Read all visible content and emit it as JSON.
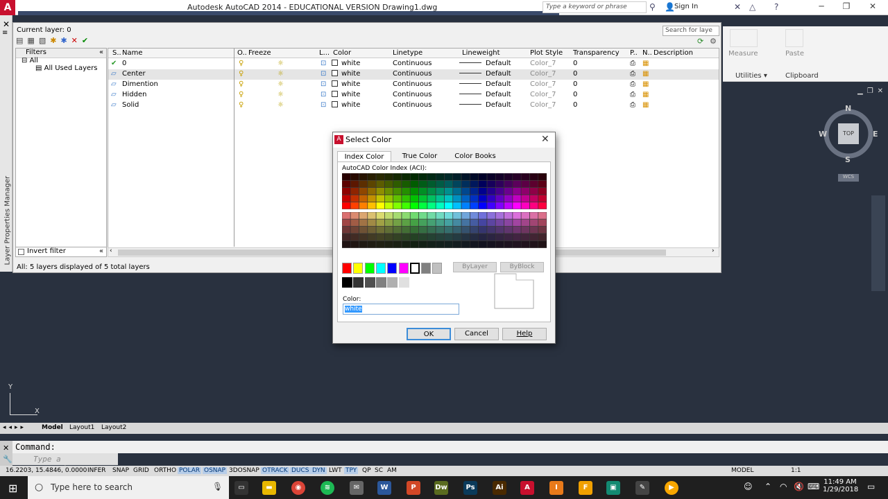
{
  "window": {
    "title": "Autodesk AutoCAD 2014 - EDUCATIONAL VERSION    Drawing1.dwg",
    "app_logo": "A",
    "search_placeholder": "Type a keyword or phrase",
    "sign_in": "Sign In"
  },
  "layer_manager": {
    "current_layer": "Current layer: 0",
    "search_placeholder": "Search for laye",
    "side_label": "Layer Properties Manager",
    "filters_header": "Filters",
    "tree": [
      "All",
      "All Used Layers"
    ],
    "invert_filter": "Invert filter",
    "columns": [
      "S..",
      "Name",
      "O..",
      "Freeze",
      "L...",
      "Color",
      "Linetype",
      "Lineweight",
      "Plot Style",
      "Transparency",
      "P..",
      "N..",
      "Description"
    ],
    "layers": [
      {
        "name": "0",
        "color": "white",
        "linetype": "Continuous",
        "lineweight": "Default",
        "plot_style": "Color_7",
        "transparency": "0"
      },
      {
        "name": "Center",
        "color": "white",
        "linetype": "Continuous",
        "lineweight": "Default",
        "plot_style": "Color_7",
        "transparency": "0"
      },
      {
        "name": "Dimention",
        "color": "white",
        "linetype": "Continuous",
        "lineweight": "Default",
        "plot_style": "Color_7",
        "transparency": "0"
      },
      {
        "name": "Hidden",
        "color": "white",
        "linetype": "Continuous",
        "lineweight": "Default",
        "plot_style": "Color_7",
        "transparency": "0"
      },
      {
        "name": "Solid",
        "color": "white",
        "linetype": "Continuous",
        "lineweight": "Default",
        "plot_style": "Color_7",
        "transparency": "0"
      }
    ],
    "status": "All: 5 layers displayed of 5 total layers"
  },
  "ribbon": {
    "measure": "Measure",
    "paste": "Paste",
    "utilities": "Utilities ▾",
    "clipboard": "Clipboard"
  },
  "viewcube": {
    "n": "N",
    "s": "S",
    "e": "E",
    "w": "W",
    "top": "TOP",
    "wcs": "WCS"
  },
  "dialog": {
    "title": "Select Color",
    "tabs": [
      "Index Color",
      "True Color",
      "Color Books"
    ],
    "aci_label": "AutoCAD Color Index (ACI):",
    "bylayer": "ByLayer",
    "byblock": "ByBlock",
    "color_label": "Color:",
    "color_value": "white",
    "ok": "OK",
    "cancel": "Cancel",
    "help": "Help"
  },
  "layout_tabs": [
    "Model",
    "Layout1",
    "Layout2"
  ],
  "axis": {
    "y": "Y",
    "x": "X"
  },
  "command": {
    "line": "Command:",
    "placeholder": "Type a command"
  },
  "statusbar": {
    "coords": "16.2203, 15.4846, 0.0000",
    "toggles": [
      "INFER",
      "SNAP",
      "GRID",
      "ORTHO",
      "POLAR",
      "OSNAP",
      "3DOSNAP",
      "OTRACK",
      "DUCS",
      "DYN",
      "LWT",
      "TPY",
      "QP",
      "SC",
      "AM"
    ],
    "on": [
      "POLAR",
      "OSNAP",
      "OTRACK",
      "DUCS",
      "DYN",
      "TPY"
    ],
    "model": "MODEL",
    "scale": "1:1"
  },
  "taskbar": {
    "search": "Type here to search",
    "time": "11:49 AM",
    "date": "1/29/2018"
  },
  "colors": {
    "accent": "#c8102e",
    "selection": "#3399ff"
  }
}
